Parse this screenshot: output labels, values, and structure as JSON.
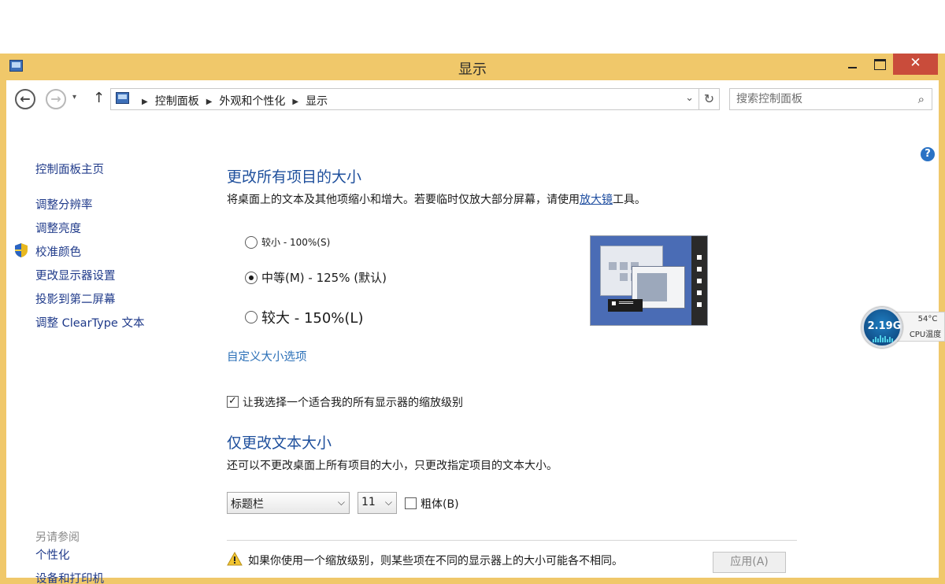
{
  "window": {
    "title": "显示",
    "controls": {
      "minimize": "minimize",
      "maximize": "maximize",
      "close": "✕"
    }
  },
  "nav": {
    "breadcrumbs": [
      "控制面板",
      "外观和个性化",
      "显示"
    ],
    "search_placeholder": "搜索控制面板"
  },
  "sidebar": {
    "home": "控制面板主页",
    "items": [
      "调整分辨率",
      "调整亮度",
      "校准颜色",
      "更改显示器设置",
      "投影到第二屏幕",
      "调整 ClearType 文本"
    ],
    "see_also_label": "另请参阅",
    "see_also": [
      "个性化",
      "设备和打印机"
    ]
  },
  "main": {
    "size_heading": "更改所有项目的大小",
    "size_desc_pre": "将桌面上的文本及其他项缩小和增大。若要临时仅放大部分屏幕，请使用",
    "size_desc_link": "放大镜",
    "size_desc_post": "工具。",
    "options": [
      {
        "label": "较小 - 100%(S)",
        "selected": false
      },
      {
        "label": "中等(M) - 125% (默认)",
        "selected": true
      },
      {
        "label": "较大 - 150%(L)",
        "selected": false
      }
    ],
    "custom_link": "自定义大小选项",
    "scale_checkbox": {
      "label": "让我选择一个适合我的所有显示器的缩放级别",
      "checked": true
    },
    "text_heading": "仅更改文本大小",
    "text_desc": "还可以不更改桌面上所有项目的大小，只更改指定项目的文本大小。",
    "item_select": "标题栏",
    "size_select": "11",
    "bold_checkbox": {
      "label": "粗体(B)",
      "checked": false
    },
    "warning": "如果你使用一个缩放级别，则某些项在不同的显示器上的大小可能各不相同。",
    "apply": "应用(A)"
  },
  "cpu_widget": {
    "frequency": "2.19G",
    "temperature": "54°C",
    "label": "CPU温度"
  },
  "colors": {
    "frame": "#f0c86a",
    "close": "#c94c3b",
    "heading": "#1e4f9c",
    "link": "#1f3a8a"
  }
}
